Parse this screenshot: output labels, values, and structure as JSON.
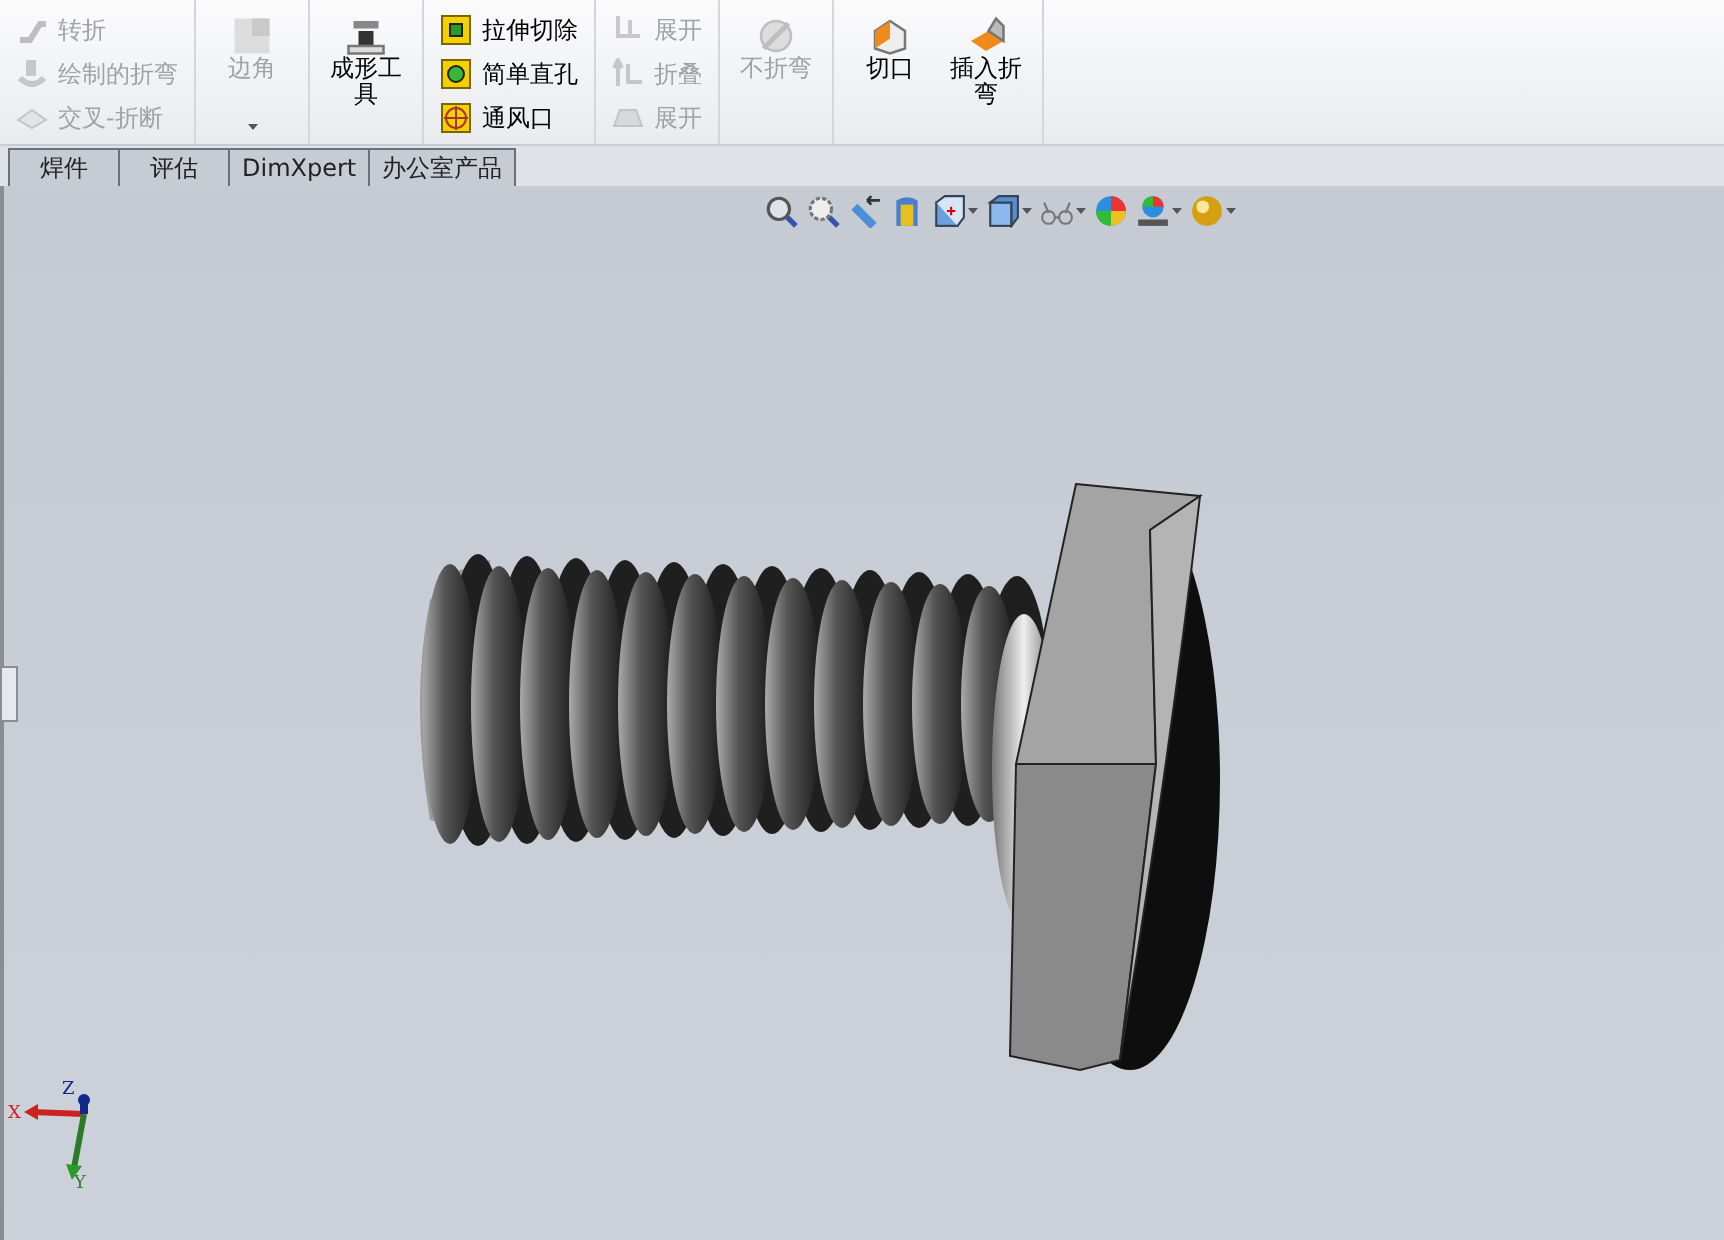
{
  "ribbon": {
    "groups": [
      {
        "kind": "stack",
        "items": [
          {
            "label": "转折",
            "disabled": true
          },
          {
            "label": "绘制的折弯",
            "disabled": true
          },
          {
            "label": "交叉-折断",
            "disabled": true
          }
        ]
      },
      {
        "kind": "big",
        "items": [
          {
            "label": "边角",
            "disabled": true,
            "dropdown": true
          }
        ]
      },
      {
        "kind": "big",
        "items": [
          {
            "label": "成形工具",
            "disabled": false
          }
        ]
      },
      {
        "kind": "stack",
        "items": [
          {
            "label": "拉伸切除",
            "disabled": false
          },
          {
            "label": "简单直孔",
            "disabled": false
          },
          {
            "label": "通风口",
            "disabled": false
          }
        ]
      },
      {
        "kind": "stack",
        "items": [
          {
            "label": "展开",
            "disabled": true
          },
          {
            "label": "折叠",
            "disabled": true
          },
          {
            "label": "展开",
            "disabled": true
          }
        ]
      },
      {
        "kind": "big",
        "items": [
          {
            "label": "不折弯",
            "disabled": true
          }
        ]
      },
      {
        "kind": "big",
        "items": [
          {
            "label": "切口",
            "disabled": false
          },
          {
            "label": "插入折弯",
            "disabled": false
          }
        ]
      }
    ]
  },
  "tabs": [
    {
      "label": "焊件",
      "selected": false
    },
    {
      "label": "评估",
      "selected": false
    },
    {
      "label": "DimXpert",
      "selected": false
    },
    {
      "label": "办公室产品",
      "selected": false
    }
  ],
  "view_toolbar": [
    {
      "dropdown": false
    },
    {
      "dropdown": false
    },
    {
      "dropdown": false
    },
    {
      "dropdown": false
    },
    {
      "dropdown": true
    },
    {
      "dropdown": true
    },
    {
      "dropdown": true
    },
    {
      "dropdown": false
    },
    {
      "dropdown": true
    },
    {
      "dropdown": true
    }
  ],
  "triad": {
    "x": "X",
    "y": "Y",
    "z": "Z"
  }
}
